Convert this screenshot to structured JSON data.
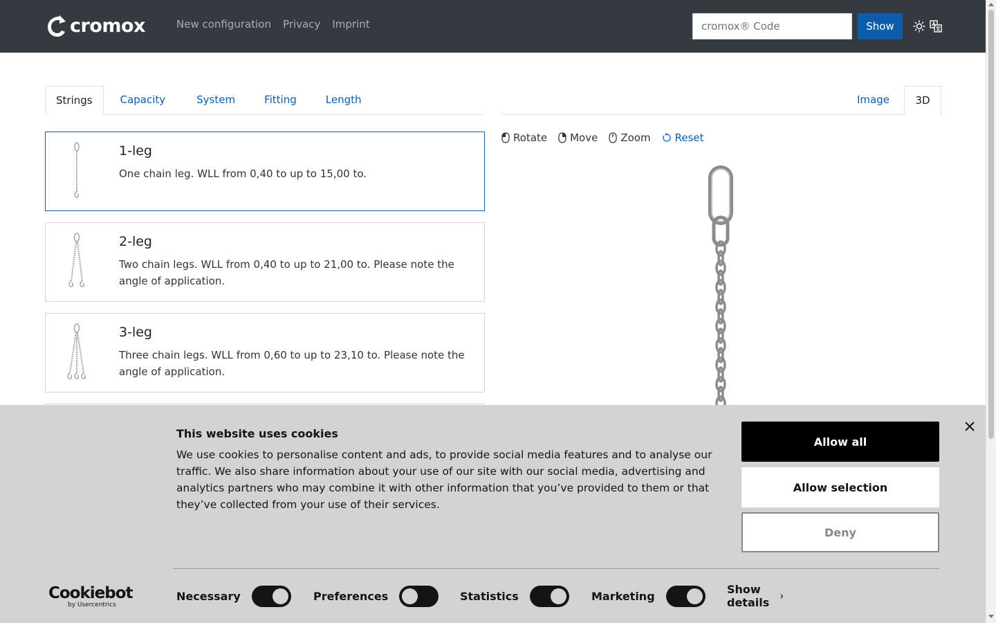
{
  "header": {
    "logo_text": "cromox",
    "nav": [
      "New configuration",
      "Privacy",
      "Imprint"
    ],
    "code_placeholder": "cromox® Code",
    "show_label": "Show",
    "icons": [
      "sun-icon",
      "translate-icon"
    ]
  },
  "config_tabs": [
    {
      "label": "Strings",
      "active": true
    },
    {
      "label": "Capacity",
      "active": false
    },
    {
      "label": "System",
      "active": false
    },
    {
      "label": "Fitting",
      "active": false
    },
    {
      "label": "Length",
      "active": false
    }
  ],
  "options": [
    {
      "title": "1-leg",
      "description": "One chain leg. WLL from 0,40 to up to 15,00 to.",
      "selected": true
    },
    {
      "title": "2-leg",
      "description": "Two chain legs. WLL from 0,40 to up to 21,00 to. Please note the angle of application.",
      "selected": false
    },
    {
      "title": "3-leg",
      "description": "Three chain legs. WLL from 0,60 to up to 23,10 to. Please note the angle of application.",
      "selected": false
    }
  ],
  "view_tabs": [
    {
      "label": "Image",
      "active": false
    },
    {
      "label": "3D",
      "active": true
    }
  ],
  "controls": {
    "rotate": "Rotate",
    "move": "Move",
    "zoom": "Zoom",
    "reset": "Reset"
  },
  "cookie": {
    "title": "This website uses cookies",
    "text": "We use cookies to personalise content and ads, to provide social media features and to analyse our traffic. We also share information about your use of our site with our social media, advertising and analytics partners who may combine it with other information that you’ve provided to them or that they’ve collected from your use of their services.",
    "allow_all": "Allow all",
    "allow_selection": "Allow selection",
    "deny": "Deny",
    "brand": "Cookiebot",
    "brand_sub": "by Usercentrics",
    "toggles": [
      {
        "label": "Necessary",
        "on": true
      },
      {
        "label": "Preferences",
        "on": false
      },
      {
        "label": "Statistics",
        "on": true
      },
      {
        "label": "Marketing",
        "on": true
      }
    ],
    "show_details": "Show details"
  }
}
